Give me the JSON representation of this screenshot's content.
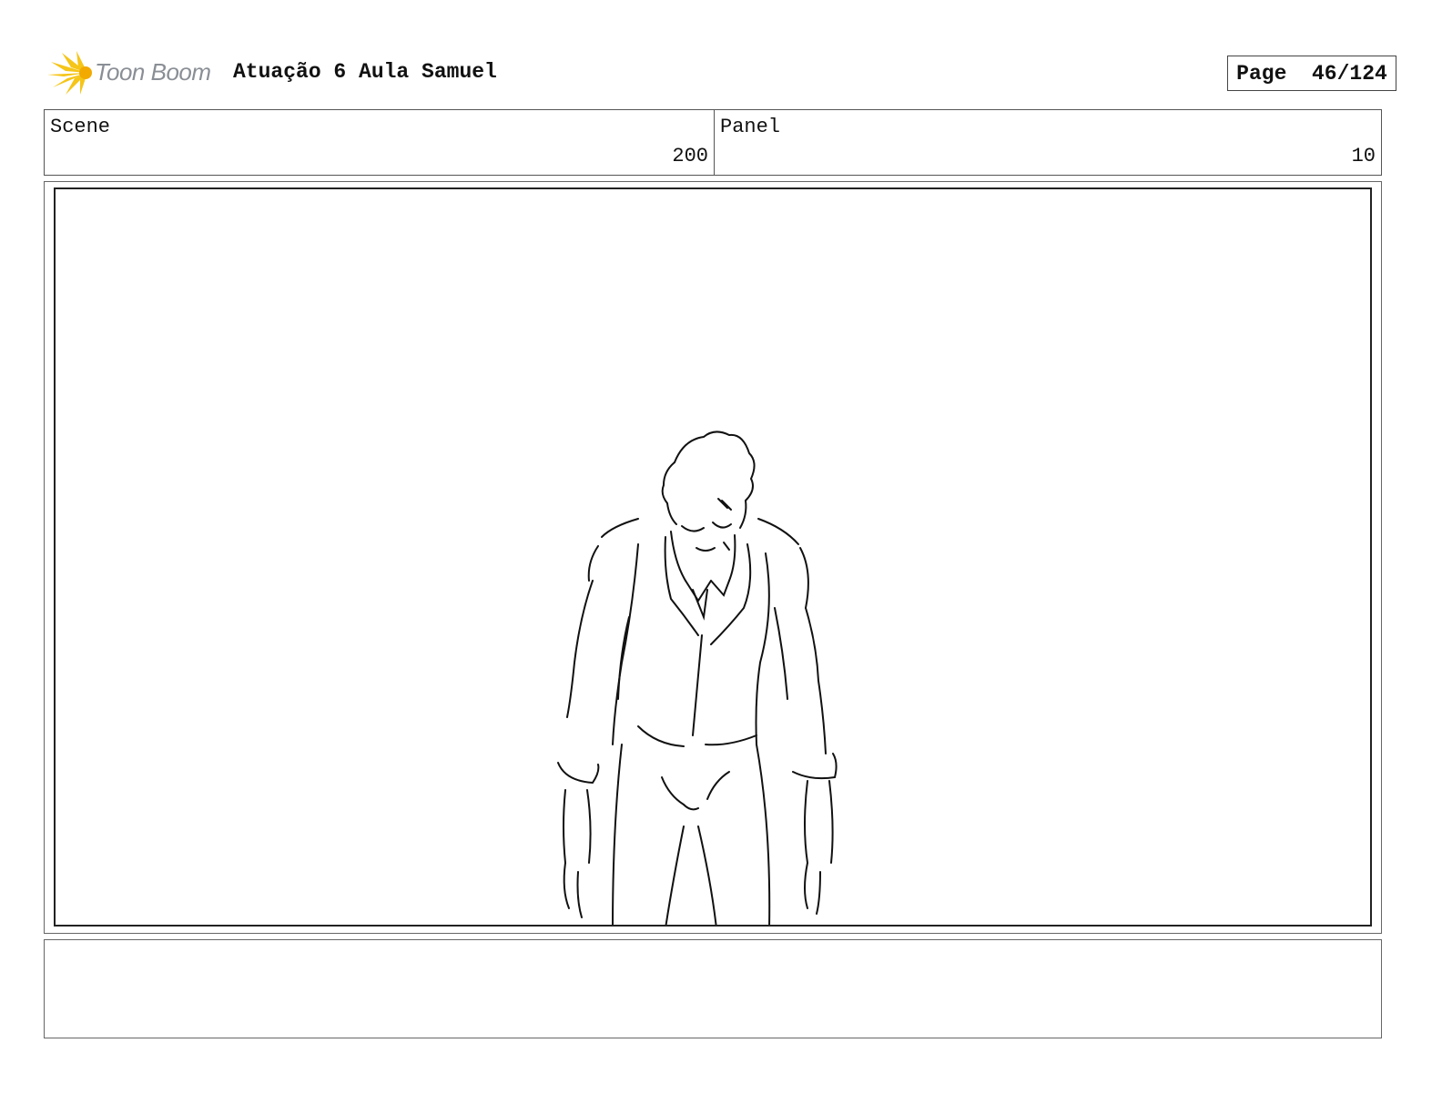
{
  "header": {
    "logo_text": "Toon Boom",
    "project_title": "Atuação 6 Aula Samuel",
    "page_label": "Page",
    "page_number": "46/124"
  },
  "info": {
    "scene_label": "Scene",
    "scene_value": "200",
    "panel_label": "Panel",
    "panel_value": "10"
  },
  "notes": {
    "text": ""
  }
}
